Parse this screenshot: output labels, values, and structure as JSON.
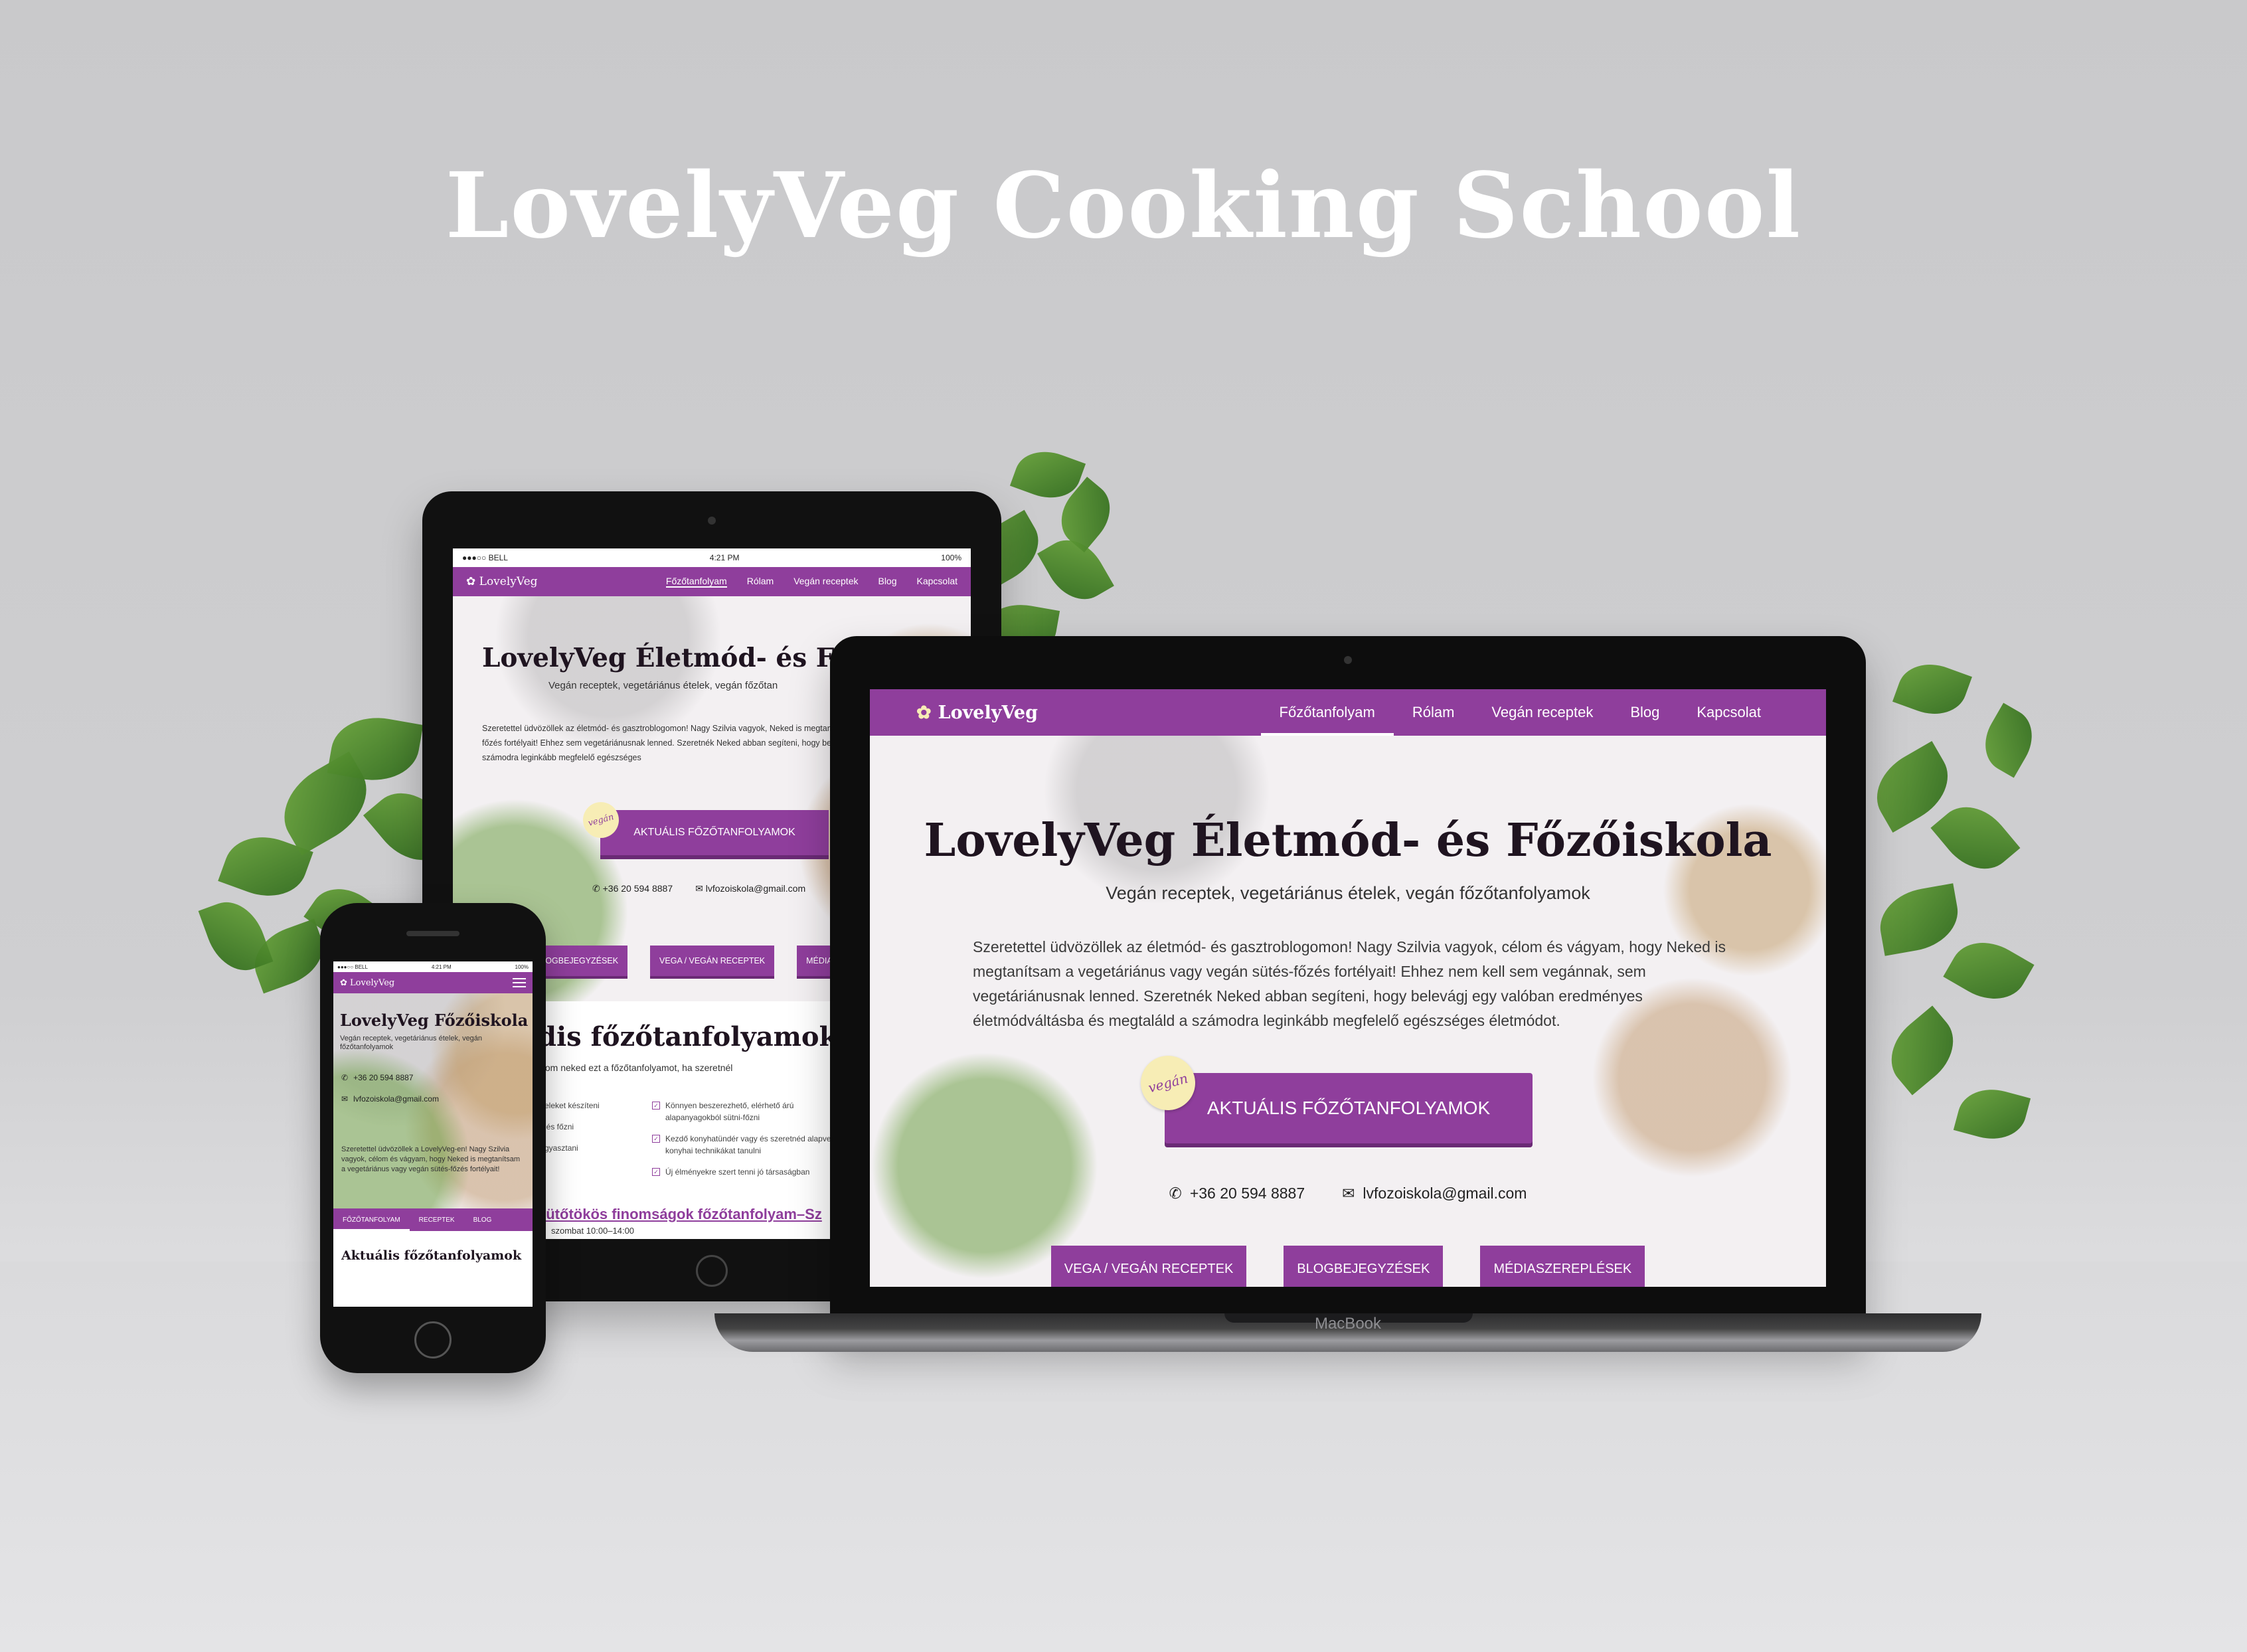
{
  "headline": "LovelyVeg Cooking School",
  "site": {
    "logo": "LovelyVeg",
    "nav": [
      "Főzőtanfolyam",
      "Rólam",
      "Vegán receptek",
      "Blog",
      "Kapcsolat"
    ],
    "hero_title": "LovelyVeg Életmód- és Főzőiskola",
    "hero_subtitle": "Vegán receptek, vegetáriánus ételek, vegán főzőtanfolyamok",
    "intro": "Szeretettel üdvözöllek az életmód- és gasztroblogomon! Nagy Szilvia vagyok, célom és vágyam, hogy Neked is megtanítsam a vegetáriánus vagy vegán sütés-főzés fortélyait! Ehhez nem kell sem vegánnak, sem vegetáriánusnak lenned. Szeretnék Neked abban segíteni, hogy belevágj egy valóban eredményes életmódváltásba és megtaláld a számodra leginkább megfelelő egészséges életmódot.",
    "badge": "vegán",
    "cta": "Aktuális főzőtanfolyamok",
    "phone": "+36 20 594 8887",
    "email": "lvfozoiskola@gmail.com",
    "buttons": [
      "Vega / vegán receptek",
      "Blogbejegyzések",
      "Médiaszereplések"
    ]
  },
  "tablet": {
    "status_carrier": "●●●○○ BELL",
    "status_time": "4:21 PM",
    "status_battery": "100%",
    "nav": [
      "Főzőtanfolyam",
      "Rólam",
      "Vegán receptek",
      "Blog",
      "Kapcsolat"
    ],
    "hero_title": "LovelyVeg Életmód- és Fő",
    "hero_subtitle": "Vegán receptek, vegetáriánus ételek, vegán főzőtan",
    "intro": "Szeretettel üdvözöllek az életmód- és gasztroblogomon! Nagy Szilvia vagyok, Neked is megtanítsam a vegetáriánus vagy vegán sütés-főzés fortélyait! Ehhez sem vegetáriánusnak lenned. Szeretnék Neked abban segíteni, hogy belevágj életmódváltásba és megtaláld a számodra leginkább megfelelő egészséges",
    "buttons": [
      "Blogbejegyzések",
      "Vega / vegán receptek",
      "Média"
    ],
    "section_title": "dis főzőtanfolyamok",
    "section_text": "nlom neked ezt a főzőtanfolyamot, ha szeretnél",
    "list_left": [
      "ételeket készíteni",
      "ni és főzni",
      "fogyasztani"
    ],
    "list_right": [
      "Könnyen beszerezhető, elérhető árú alapanyagokból sütni-főzni",
      "Kezdő konyhatündér vagy és szeretnéd alapvető konyhai technikákat tanulni",
      "Új élményekre szert tenni jó társaságban"
    ],
    "event_title": "sütőtökös finomságok főzőtanfolyam–Sz",
    "event_time": "szombat 10:00–14:00"
  },
  "phone": {
    "status_carrier": "●●●○○ BELL",
    "status_time": "4:21 PM",
    "status_battery": "100%",
    "hero_title": "LovelyVeg Főzőiskola",
    "hero_subtitle": "Vegán receptek, vegetáriánus ételek, vegán főzőtanfolyamok",
    "intro": "Szeretettel üdvözöllek a LovelyVeg-en! Nagy Szilvia vagyok, célom és vágyam, hogy Neked is megtanítsam a vegetáriánus vagy vegán sütés-főzés fortélyait!",
    "tabs": [
      "Főzőtanfolyam",
      "Receptek",
      "Blog"
    ],
    "section_title": "Aktuális főzőtanfolyamok"
  },
  "laptop_label": "MacBook",
  "colors": {
    "accent": "#8f3e9c",
    "badge": "#f7edb5"
  }
}
